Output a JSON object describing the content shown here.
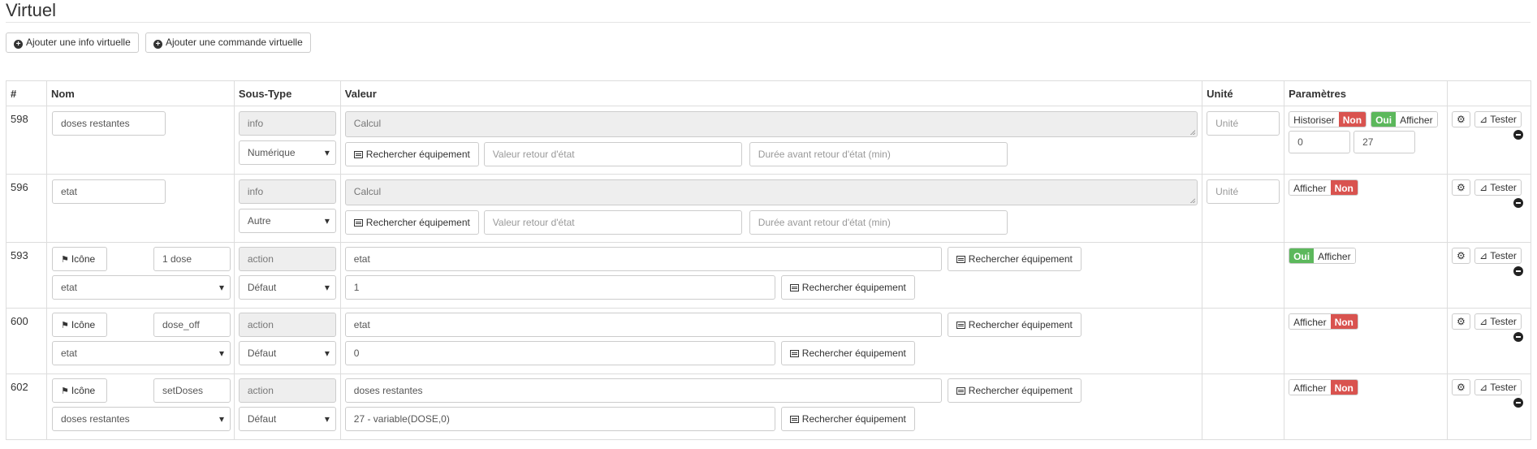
{
  "title": "Virtuel",
  "buttons": {
    "add_info": "Ajouter une info virtuelle",
    "add_command": "Ajouter une commande virtuelle"
  },
  "columns": [
    "#",
    "Nom",
    "Sous-Type",
    "Valeur",
    "Unité",
    "Paramètres"
  ],
  "common": {
    "search_label": "Rechercher équipement",
    "icon_label": "Icône",
    "tester_label": "Tester",
    "unit_placeholder": "Unité",
    "retour_placeholder": "Valeur retour d'état",
    "duree_placeholder": "Durée avant retour d'état (min)",
    "calcul_placeholder": "Calcul",
    "historiser": "Historiser",
    "afficher": "Afficher",
    "oui": "Oui",
    "non": "Non"
  },
  "rows": [
    {
      "id": "598",
      "name": "doses restantes",
      "type": "info",
      "subtype": "Numérique",
      "min": "0",
      "max": "27"
    },
    {
      "id": "596",
      "name": "etat",
      "type": "info",
      "subtype": "Autre"
    },
    {
      "id": "593",
      "name": "1 dose",
      "type": "action",
      "subtype": "Défaut",
      "target": "etat",
      "value_cmd": "etat",
      "value": "1"
    },
    {
      "id": "600",
      "name": "dose_off",
      "type": "action",
      "subtype": "Défaut",
      "target": "etat",
      "value_cmd": "etat",
      "value": "0"
    },
    {
      "id": "602",
      "name": "setDoses",
      "type": "action",
      "subtype": "Défaut",
      "target": "doses restantes",
      "value_cmd": "doses restantes",
      "value": "27 - variable(DOSE,0)"
    }
  ],
  "colors": {
    "red": "#d9534f",
    "green": "#5cb85c"
  }
}
